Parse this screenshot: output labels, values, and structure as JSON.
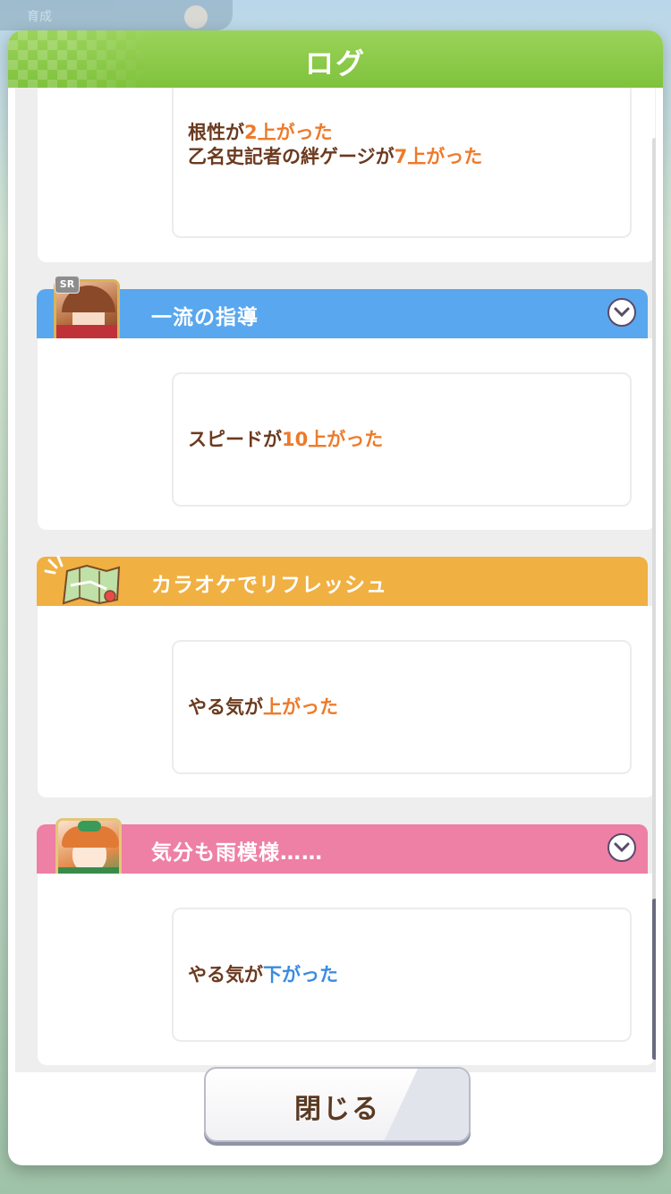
{
  "background": {
    "topbar_text": "育成"
  },
  "modal": {
    "title": "ログ"
  },
  "colors": {
    "header_green": "#8cc84b",
    "speed_blue": "#59a7ee",
    "event_orange": "#f0b042",
    "mood_pink": "#ee7fa5",
    "gain_orange": "#ee7a2a",
    "loss_blue": "#3b8be0",
    "text_brown": "#6b3a1f"
  },
  "entries": [
    {
      "lines": [
        {
          "prefix": "根性が",
          "value": "2上がった"
        },
        {
          "prefix": "乙名史記者の絆ゲージが",
          "value": "7上がった"
        }
      ]
    },
    {
      "title": "一流の指導",
      "icon": "support-card-portrait",
      "badge": "SR",
      "lines": [
        {
          "prefix": "スピードが",
          "value": "10上がった"
        }
      ]
    },
    {
      "title": "カラオケでリフレッシュ",
      "icon": "map-icon",
      "lines": [
        {
          "prefix": "やる気が",
          "value": "上がった"
        }
      ]
    },
    {
      "title": "気分も雨模様……",
      "icon": "character-portrait",
      "lines": [
        {
          "prefix": "やる気が",
          "value": "下がった"
        }
      ]
    }
  ],
  "footer": {
    "close_label": "閉じる"
  }
}
